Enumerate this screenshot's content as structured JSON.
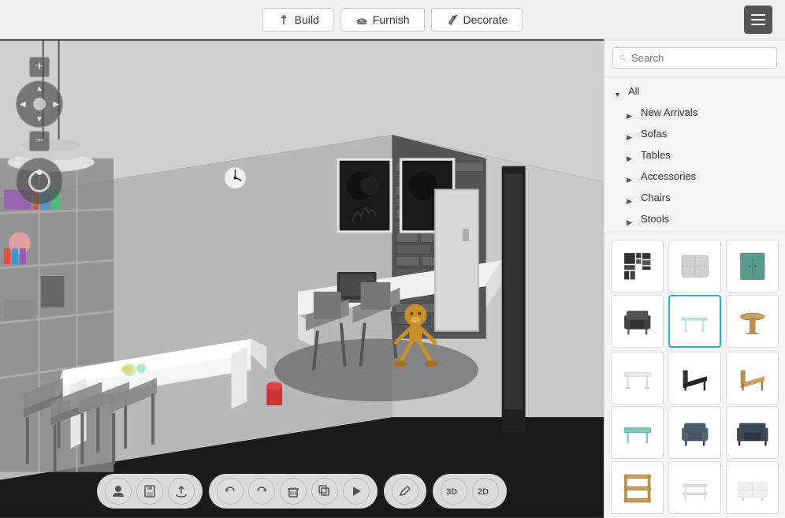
{
  "topbar": {
    "build_label": "Build",
    "furnish_label": "Furnish",
    "decorate_label": "Decorate"
  },
  "search": {
    "placeholder": "Search"
  },
  "categories": [
    {
      "id": "all",
      "label": "All",
      "arrow": "down",
      "expanded": true
    },
    {
      "id": "new-arrivals",
      "label": "New Arrivals",
      "arrow": "right"
    },
    {
      "id": "sofas",
      "label": "Sofas",
      "arrow": "right"
    },
    {
      "id": "tables",
      "label": "Tables",
      "arrow": "right"
    },
    {
      "id": "accessories",
      "label": "Accessories",
      "arrow": "right"
    },
    {
      "id": "chairs",
      "label": "Chairs",
      "arrow": "right"
    },
    {
      "id": "stools",
      "label": "Stools",
      "arrow": "right"
    }
  ],
  "items": [
    {
      "id": "item-1",
      "type": "wall-art",
      "selected": false
    },
    {
      "id": "item-2",
      "type": "pillow",
      "selected": false
    },
    {
      "id": "item-3",
      "type": "cabinet",
      "selected": false
    },
    {
      "id": "item-4",
      "type": "armchair-dark",
      "selected": false
    },
    {
      "id": "item-5",
      "type": "table-glass",
      "selected": true
    },
    {
      "id": "item-6",
      "type": "side-table-wood",
      "selected": false
    },
    {
      "id": "item-7",
      "type": "coffee-table-white",
      "selected": false
    },
    {
      "id": "item-8",
      "type": "chair-black",
      "selected": false
    },
    {
      "id": "item-9",
      "type": "chair-wood",
      "selected": false
    },
    {
      "id": "item-10",
      "type": "coffee-table-teal",
      "selected": false
    },
    {
      "id": "item-11",
      "type": "armchair-blue",
      "selected": false
    },
    {
      "id": "item-12",
      "type": "sofa-dark",
      "selected": false
    },
    {
      "id": "item-13",
      "type": "shelf-wood",
      "selected": false
    },
    {
      "id": "item-14",
      "type": "side-table-metal",
      "selected": false
    },
    {
      "id": "item-15",
      "type": "tv-stand-white",
      "selected": false
    }
  ],
  "bottom_toolbar": {
    "groups": [
      {
        "id": "group1",
        "buttons": [
          {
            "id": "profile-btn",
            "icon": "person"
          },
          {
            "id": "save-btn",
            "icon": "floppy"
          },
          {
            "id": "upload-btn",
            "icon": "upload"
          }
        ]
      },
      {
        "id": "group2",
        "buttons": [
          {
            "id": "rotate-left-btn",
            "icon": "rotate-left"
          },
          {
            "id": "undo-btn",
            "icon": "undo"
          },
          {
            "id": "delete-btn",
            "icon": "trash"
          },
          {
            "id": "duplicate-btn",
            "icon": "duplicate"
          },
          {
            "id": "play-btn",
            "icon": "play"
          }
        ]
      },
      {
        "id": "group3",
        "buttons": [
          {
            "id": "edit-btn",
            "icon": "pencil"
          }
        ]
      },
      {
        "id": "group4",
        "buttons": [
          {
            "id": "view-3d-btn",
            "icon": "3d"
          },
          {
            "id": "view-2d-btn",
            "icon": "2d"
          }
        ]
      }
    ]
  },
  "colors": {
    "selected_border": "#2ab0c0",
    "topbar_bg": "#f0f0f0",
    "panel_bg": "#f5f5f5",
    "accent": "#2ab0c0"
  }
}
